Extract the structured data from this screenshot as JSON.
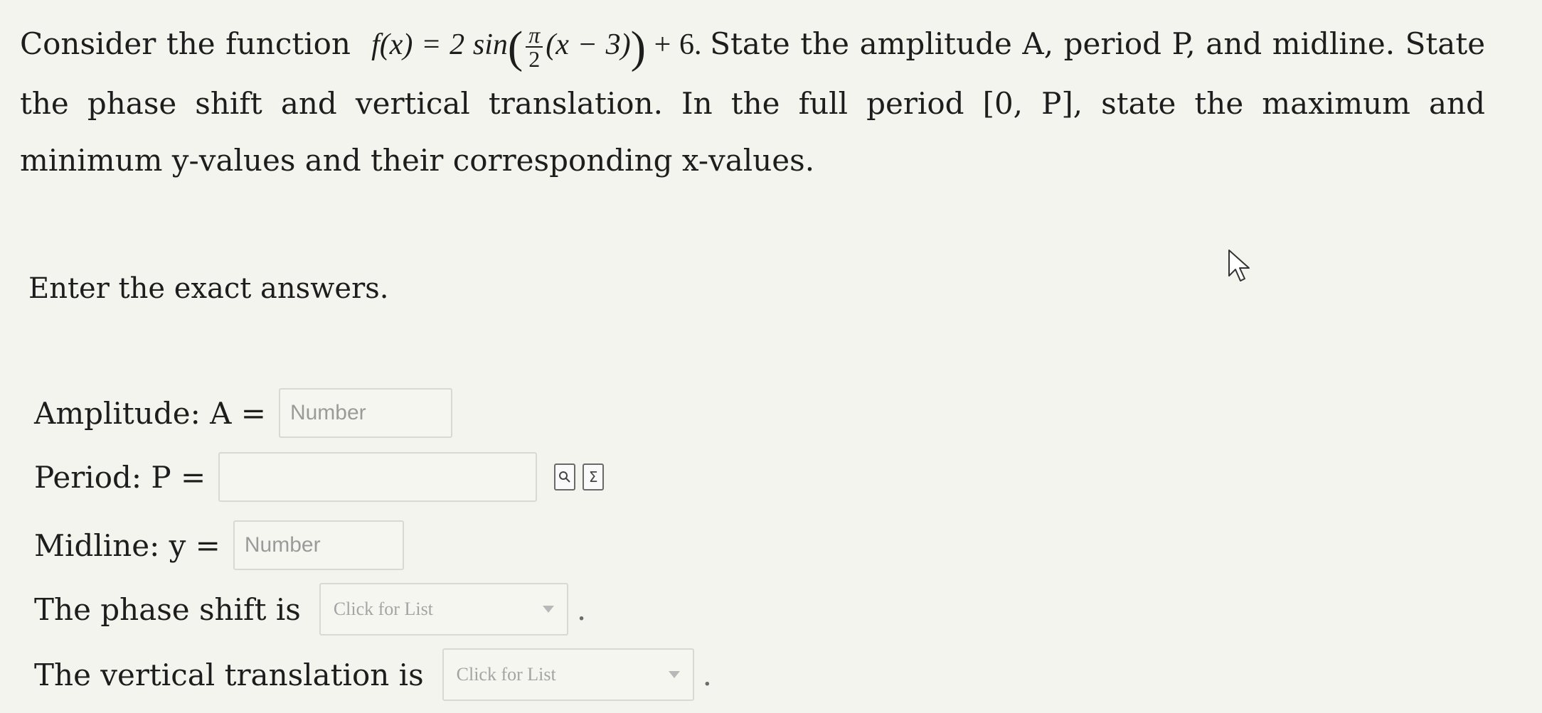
{
  "question": {
    "intro": "Consider the function",
    "fx": "f(x) = 2 sin",
    "frac_num": "π",
    "frac_den": "2",
    "inner": "(x − 3)",
    "tail": "+ 6.",
    "text_after": "State the amplitude A, period P, and midline. State the phase shift and vertical translation. In the full period [0, P], state the maximum and minimum y-values and their corresponding x-values."
  },
  "instruction": "Enter the exact answers.",
  "fields": {
    "amplitude": {
      "label": "Amplitude: A =",
      "placeholder": "Number"
    },
    "period": {
      "label": "Period: P =",
      "placeholder": ""
    },
    "midline": {
      "label": "Midline: y =",
      "placeholder": "Number"
    },
    "phase_shift": {
      "label": "The phase shift is",
      "selected": "Click for List"
    },
    "vertical_translation": {
      "label": "The vertical translation is",
      "selected": "Click for List"
    }
  },
  "icons": {
    "preview": "preview-icon",
    "equation_editor": "sigma-icon",
    "cursor": "mouse-pointer-icon"
  },
  "period_end": "."
}
